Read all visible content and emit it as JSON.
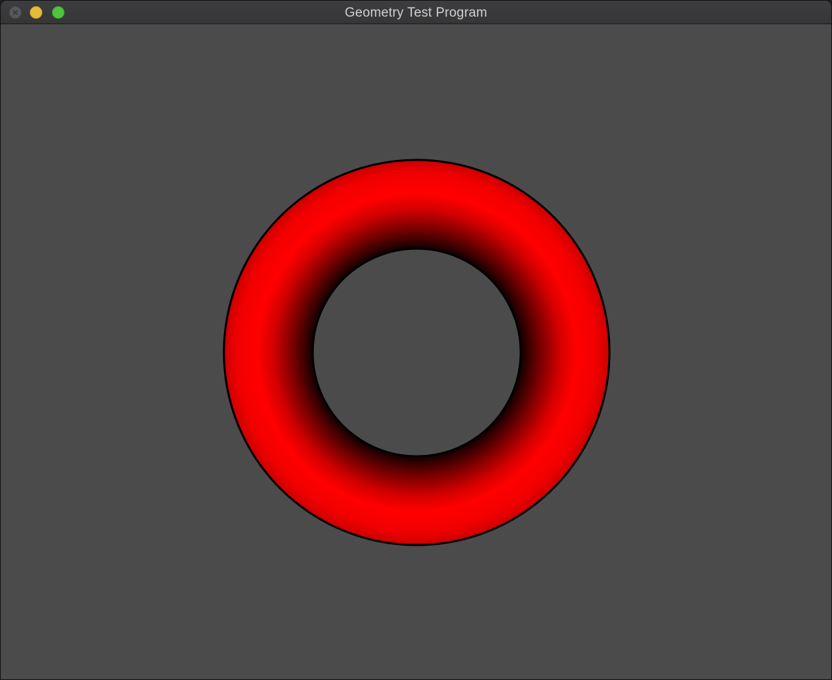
{
  "window": {
    "title": "Geometry Test Program",
    "controls": {
      "close_icon": "close-icon",
      "minimize_icon": "minimize-icon",
      "zoom_icon": "zoom-icon"
    }
  },
  "viewport": {
    "background_color": "#4b4b4b",
    "shape": {
      "type": "torus",
      "fill_color": "#ff0000",
      "shade_color": "#000000",
      "outline_color": "#000000"
    }
  }
}
